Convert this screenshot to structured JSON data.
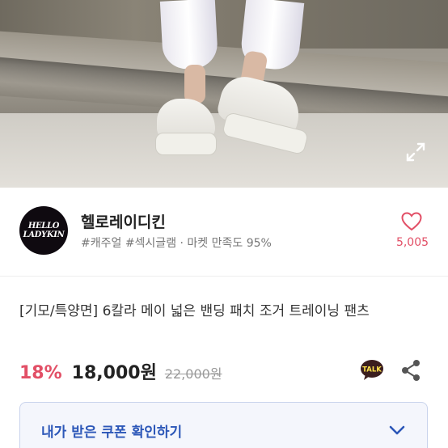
{
  "photo": {
    "alt": "white platform sneakers",
    "expand_icon": "expand-icon"
  },
  "seller": {
    "logo_line1": "HELLO",
    "logo_line2": "LADYKIN",
    "name": "헬로레이디킨",
    "tags": "#캐주얼 #섹시글램 · 마켓 만족도 95%",
    "like_icon": "heart-icon",
    "like_count": "5,005"
  },
  "product": {
    "title": "[기모/특양면] 6칼라 메이 넓은 밴딩 패치 조거 트레이닝 팬츠",
    "discount": "18%",
    "price": "18,000원",
    "original_price": "22,000원",
    "talk_label": "TALK",
    "share_icon": "share-icon"
  },
  "coupon": {
    "label": "내가 받은 쿠폰 확인하기",
    "chevron_icon": "chevron-down-icon"
  },
  "colors": {
    "accent_pink": "#e24f66",
    "coupon_blue": "#2c57b8",
    "talk_yellow": "#3b1e1e"
  }
}
